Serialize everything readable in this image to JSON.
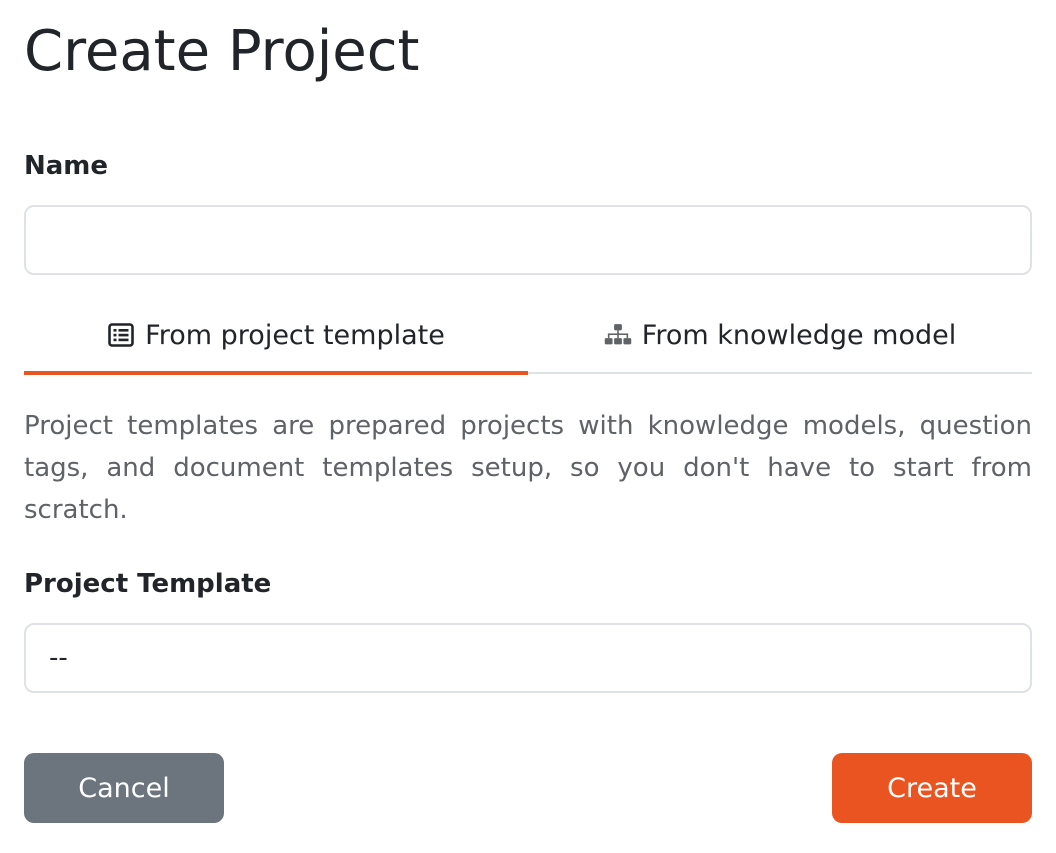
{
  "page": {
    "title": "Create Project"
  },
  "form": {
    "name_label": "Name",
    "name_value": "",
    "name_placeholder": "",
    "tabs": [
      {
        "label": "From project template",
        "icon": "list-icon",
        "active": true
      },
      {
        "label": "From knowledge model",
        "icon": "sitemap-icon",
        "active": false
      }
    ],
    "description": "Project templates are prepared projects with knowledge models, question tags, and document templates setup, so you don't have to start from scratch.",
    "template_label": "Project Template",
    "template_selected": "--"
  },
  "actions": {
    "cancel_label": "Cancel",
    "create_label": "Create"
  },
  "colors": {
    "accent": "#e95420",
    "secondary": "#6c757d",
    "border": "#dee2e6",
    "muted_text": "#5f6266"
  }
}
